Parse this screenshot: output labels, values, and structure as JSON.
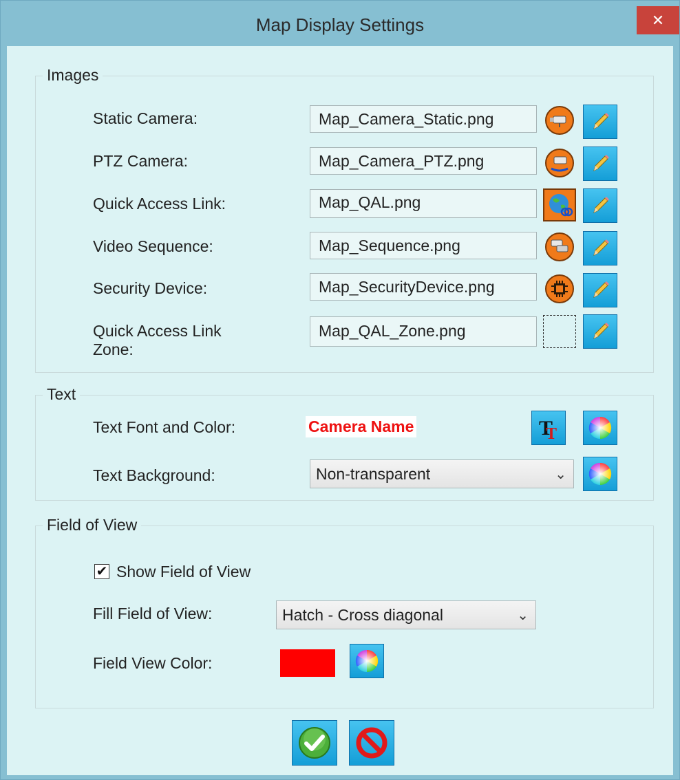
{
  "window": {
    "title": "Map Display Settings",
    "close_glyph": "✕"
  },
  "images": {
    "legend": "Images",
    "rows": [
      {
        "label": "Static Camera:",
        "value": "Map_Camera_Static.png",
        "icon": "static-camera-icon"
      },
      {
        "label": "PTZ Camera:",
        "value": "Map_Camera_PTZ.png",
        "icon": "ptz-camera-icon"
      },
      {
        "label": "Quick Access Link:",
        "value": "Map_QAL.png",
        "icon": "globe-link-icon"
      },
      {
        "label": "Video Sequence:",
        "value": "Map_Sequence.png",
        "icon": "sequence-camera-icon"
      },
      {
        "label": "Security Device:",
        "value": "Map_SecurityDevice.png",
        "icon": "chip-icon"
      },
      {
        "label": "Quick Access Link Zone:",
        "value": "Map_QAL_Zone.png",
        "icon": "zone-outline-icon"
      }
    ],
    "edit_icon": "pencil-icon"
  },
  "text": {
    "legend": "Text",
    "font_label": "Text Font and Color:",
    "sample": "Camera Name",
    "sample_color": "#ee1111",
    "background_label": "Text Background:",
    "background_value": "Non-transparent"
  },
  "fov": {
    "legend": "Field of View",
    "show_label": "Show Field of View",
    "show_checked": true,
    "check_glyph": "✔",
    "fill_label": "Fill Field of View:",
    "fill_value": "Hatch - Cross diagonal",
    "color_label": "Field View Color:",
    "color": "#ff0000"
  },
  "footer": {
    "ok_icon": "checkmark-icon",
    "cancel_icon": "no-sign-icon"
  },
  "colors": {
    "title_bar": "#86bfd2",
    "client_bg": "#dcf3f4",
    "button_blue": "#149ed7",
    "close_red": "#c8433b"
  }
}
